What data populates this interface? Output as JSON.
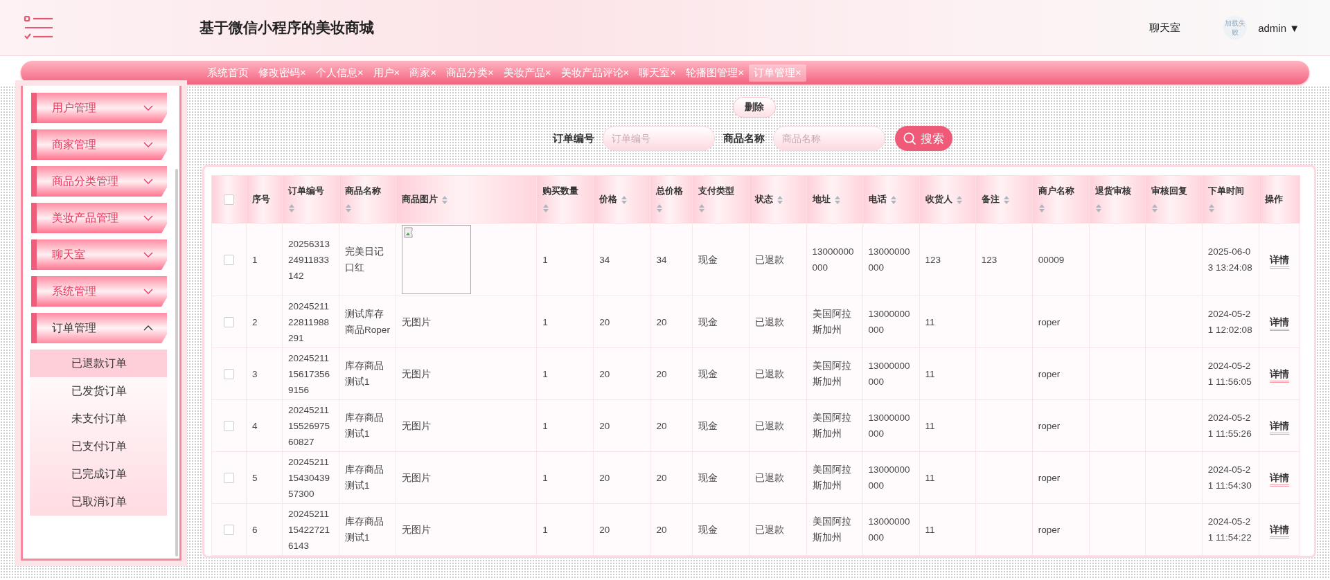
{
  "header": {
    "title": "基于微信小程序的美妆商城",
    "links": [
      "聊天室"
    ],
    "avatar_alt": "加载失败",
    "user": "admin",
    "user_caret": "▼"
  },
  "tabs": [
    {
      "label": "系统首页",
      "closable": false,
      "selected": false
    },
    {
      "label": "修改密码",
      "closable": true,
      "selected": false
    },
    {
      "label": "个人信息",
      "closable": true,
      "selected": false
    },
    {
      "label": "用户",
      "closable": true,
      "selected": false
    },
    {
      "label": "商家",
      "closable": true,
      "selected": false
    },
    {
      "label": "商品分类",
      "closable": true,
      "selected": false
    },
    {
      "label": "美妆产品",
      "closable": true,
      "selected": false
    },
    {
      "label": "美妆产品评论",
      "closable": true,
      "selected": false
    },
    {
      "label": "聊天室",
      "closable": true,
      "selected": false
    },
    {
      "label": "轮播图管理",
      "closable": true,
      "selected": false
    },
    {
      "label": "订单管理",
      "closable": true,
      "selected": true
    }
  ],
  "tab_close": "×",
  "sidebar": {
    "items": [
      {
        "label": "用户管理",
        "expanded": false
      },
      {
        "label": "商家管理",
        "expanded": false
      },
      {
        "label": "商品分类管理",
        "expanded": false
      },
      {
        "label": "美妆产品管理",
        "expanded": false
      },
      {
        "label": "聊天室",
        "expanded": false
      },
      {
        "label": "系统管理",
        "expanded": false
      },
      {
        "label": "订单管理",
        "expanded": true,
        "children": [
          {
            "label": "已退款订单",
            "selected": true
          },
          {
            "label": "已发货订单",
            "selected": false
          },
          {
            "label": "未支付订单",
            "selected": false
          },
          {
            "label": "已支付订单",
            "selected": false
          },
          {
            "label": "已完成订单",
            "selected": false
          },
          {
            "label": "已取消订单",
            "selected": false
          }
        ]
      }
    ]
  },
  "toolbar": {
    "delete_button": "删除"
  },
  "search": {
    "fields": [
      {
        "label": "订单编号",
        "placeholder": "订单编号"
      },
      {
        "label": "商品名称",
        "placeholder": "商品名称"
      }
    ],
    "button": "搜索"
  },
  "table": {
    "select_all_checked": false,
    "columns": [
      {
        "label": "序号",
        "sortable": false
      },
      {
        "label": "订单编号",
        "sortable": true
      },
      {
        "label": "商品名称",
        "sortable": true
      },
      {
        "label": "商品图片",
        "sortable": true
      },
      {
        "label": "购买数量",
        "sortable": true
      },
      {
        "label": "价格",
        "sortable": true
      },
      {
        "label": "总价格",
        "sortable": true
      },
      {
        "label": "支付类型",
        "sortable": true
      },
      {
        "label": "状态",
        "sortable": true
      },
      {
        "label": "地址",
        "sortable": true
      },
      {
        "label": "电话",
        "sortable": true
      },
      {
        "label": "收货人",
        "sortable": true
      },
      {
        "label": "备注",
        "sortable": true
      },
      {
        "label": "商户名称",
        "sortable": true
      },
      {
        "label": "退货审核",
        "sortable": true
      },
      {
        "label": "审核回复",
        "sortable": true
      },
      {
        "label": "下单时间",
        "sortable": true
      },
      {
        "label": "操作",
        "sortable": false
      }
    ],
    "rows": [
      {
        "checked": false,
        "cells": [
          "1",
          "2025631324911833142",
          "完美日记口红",
          {
            "kind": "broken_image"
          },
          "1",
          "34",
          "34",
          "现金",
          "已退款",
          "13000000000",
          "13000000000",
          "123",
          "123",
          "00009",
          "",
          "",
          "2025-06-03 13:24:08"
        ],
        "action": "详情"
      },
      {
        "checked": false,
        "cells": [
          "2",
          "2024521122811988291",
          "测试库存商品Roper",
          {
            "kind": "text",
            "text": "无图片"
          },
          "1",
          "20",
          "20",
          "现金",
          "已退款",
          "美国阿拉斯加州",
          "13000000000",
          "11",
          "",
          "roper",
          "",
          "",
          "2024-05-21 12:02:08"
        ],
        "action": "详情"
      },
      {
        "checked": false,
        "cells": [
          "3",
          "20245211156173569156",
          "库存商品测试1",
          {
            "kind": "text",
            "text": "无图片"
          },
          "1",
          "20",
          "20",
          "现金",
          "已退款",
          "美国阿拉斯加州",
          "13000000000",
          "11",
          "",
          "roper",
          "",
          "",
          "2024-05-21 11:56:05"
        ],
        "action": "详情"
      },
      {
        "checked": false,
        "cells": [
          "4",
          "202452111552697560827",
          "库存商品测试1",
          {
            "kind": "text",
            "text": "无图片"
          },
          "1",
          "20",
          "20",
          "现金",
          "已退款",
          "美国阿拉斯加州",
          "13000000000",
          "11",
          "",
          "roper",
          "",
          "",
          "2024-05-21 11:55:26"
        ],
        "action": "详情"
      },
      {
        "checked": false,
        "cells": [
          "5",
          "202452111543043957300",
          "库存商品测试1",
          {
            "kind": "text",
            "text": "无图片"
          },
          "1",
          "20",
          "20",
          "现金",
          "已退款",
          "美国阿拉斯加州",
          "13000000000",
          "11",
          "",
          "roper",
          "",
          "",
          "2024-05-21 11:54:30"
        ],
        "action": "详情"
      },
      {
        "checked": false,
        "cells": [
          "6",
          "20245211154227216143",
          "库存商品测试1",
          {
            "kind": "text",
            "text": "无图片"
          },
          "1",
          "20",
          "20",
          "现金",
          "已退款",
          "美国阿拉斯加州",
          "13000000000",
          "11",
          "",
          "roper",
          "",
          "",
          "2024-05-21 11:54:22"
        ],
        "action": "详情"
      }
    ]
  }
}
